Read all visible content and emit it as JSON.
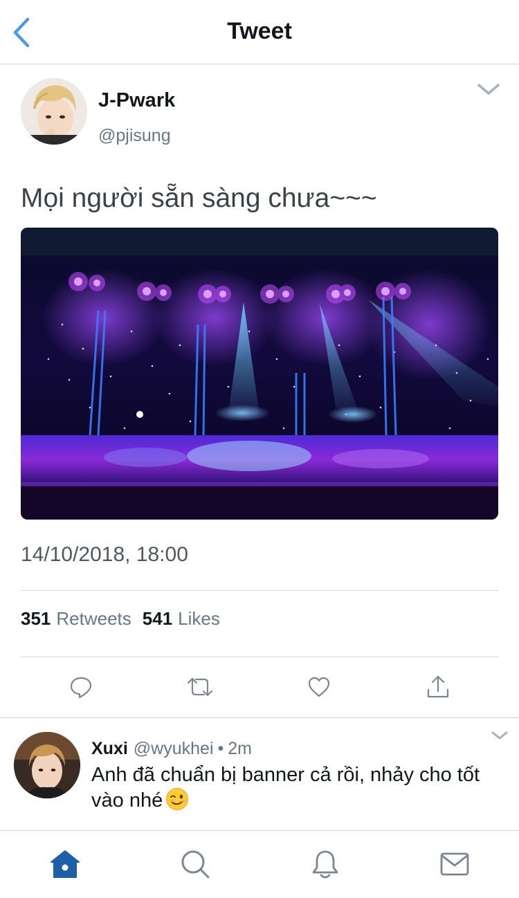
{
  "nav": {
    "title": "Tweet",
    "back_icon": "chevron-left-icon"
  },
  "tweet": {
    "author_name": "J-Pwark",
    "author_handle": "@pjisung",
    "text": "Mọi người sẵn sàng chưa~~~",
    "timestamp": "14/10/2018, 18:00",
    "retweets_count": "351",
    "retweets_label": "Retweets",
    "likes_count": "541",
    "likes_label": "Likes",
    "actions": [
      "reply-icon",
      "retweet-icon",
      "like-icon",
      "share-icon"
    ]
  },
  "reply": {
    "name": "Xuxi",
    "handle": "@wyukhei",
    "separator": "•",
    "time": "2m",
    "text": "Anh đã chuẩn bị banner cả rồi, nhảy cho tốt vào nhé"
  },
  "tab_bar": [
    "home-icon",
    "search-icon",
    "notifications-icon",
    "messages-icon"
  ],
  "colors": {
    "accent": "#4a9be0",
    "tab_active": "#1e5fa8",
    "secondary_text": "#657786",
    "icon_gray": "#7a8792"
  }
}
